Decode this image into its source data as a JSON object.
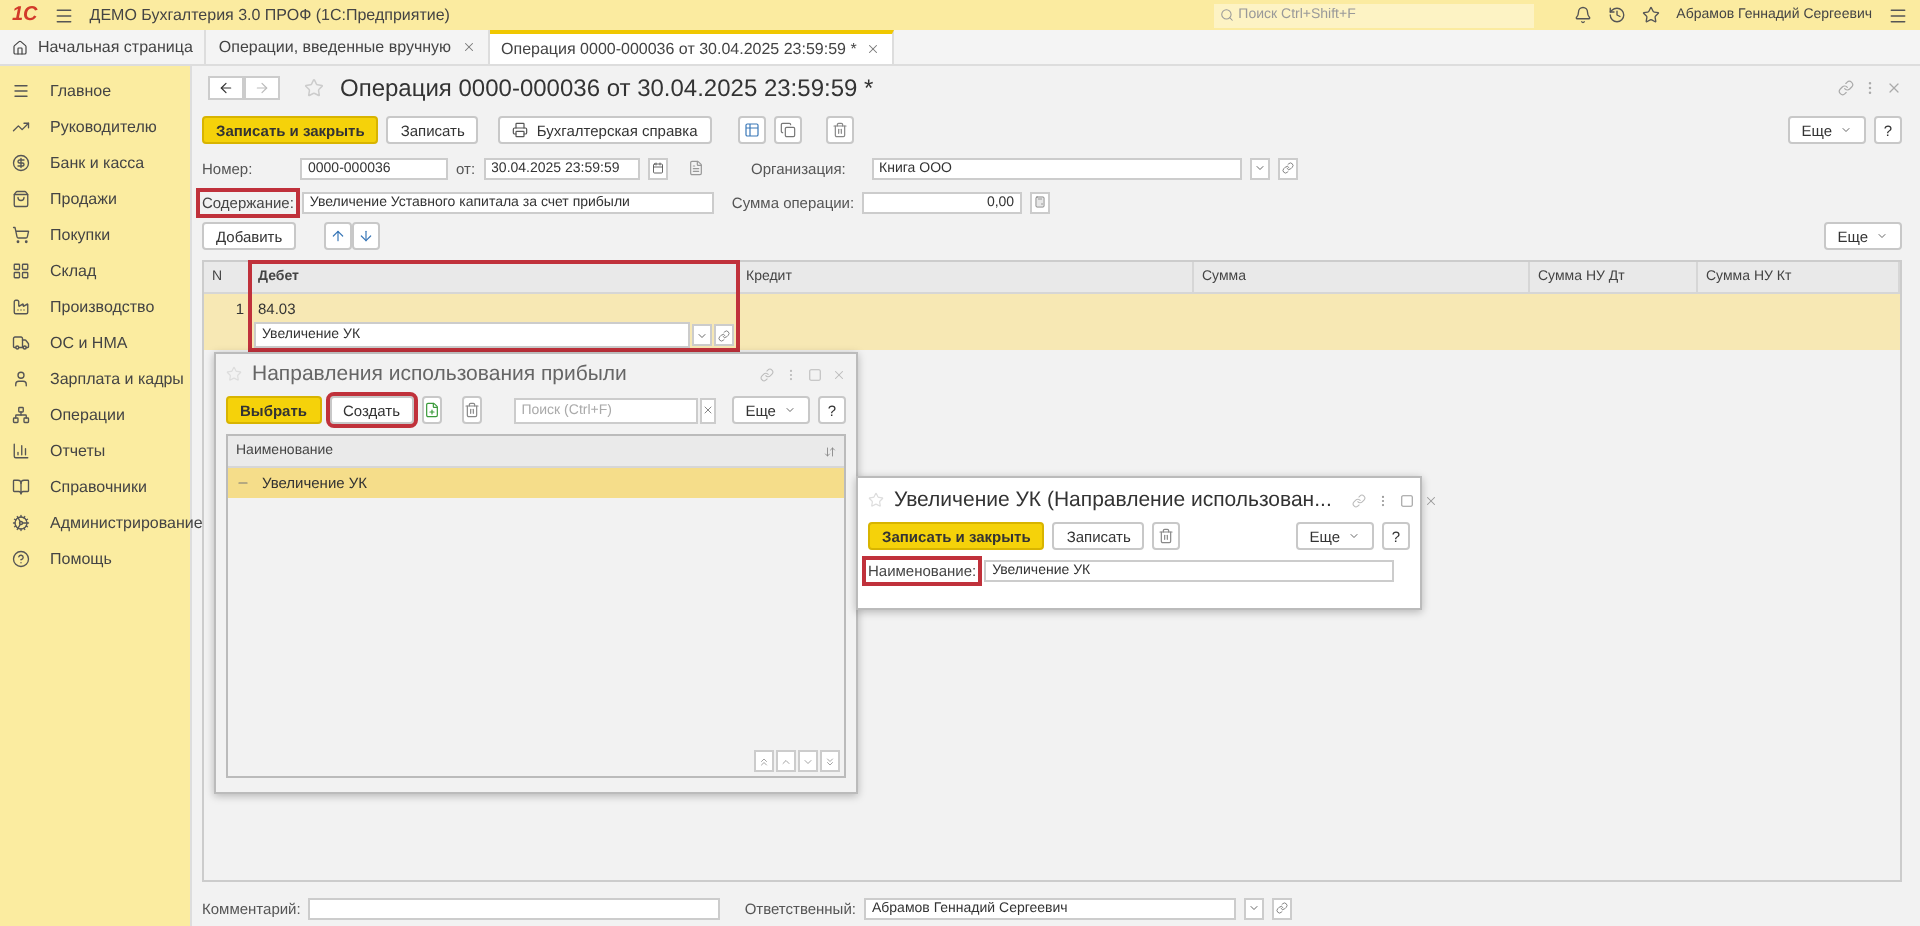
{
  "app": {
    "logo": "1С",
    "title": "ДЕМО Бухгалтерия 3.0 ПРОФ  (1С:Предприятие)",
    "search_placeholder": "Поиск Ctrl+Shift+F",
    "user": "Абрамов Геннадий Сергеевич"
  },
  "tabs": [
    {
      "label": "Начальная страница",
      "kind": "home",
      "selected": false
    },
    {
      "label": "Операции, введенные вручную",
      "kind": "page",
      "selected": false
    },
    {
      "label": "Операция 0000-000036 от 30.04.2025 23:59:59 *",
      "kind": "page",
      "selected": true
    }
  ],
  "sidebar": {
    "items": [
      {
        "label": "Главное"
      },
      {
        "label": "Руководителю"
      },
      {
        "label": "Банк и касса"
      },
      {
        "label": "Продажи"
      },
      {
        "label": "Покупки"
      },
      {
        "label": "Склад"
      },
      {
        "label": "Производство"
      },
      {
        "label": "ОС и НМА"
      },
      {
        "label": "Зарплата и кадры"
      },
      {
        "label": "Операции"
      },
      {
        "label": "Отчеты"
      },
      {
        "label": "Справочники"
      },
      {
        "label": "Администрирование"
      },
      {
        "label": "Помощь"
      }
    ]
  },
  "form": {
    "title": "Операция 0000-000036 от 30.04.2025 23:59:59 *",
    "toolbar": [
      {
        "label": "Записать и закрыть",
        "kind": "primary"
      },
      {
        "label": "Записать",
        "kind": "default"
      },
      {
        "label": "Бухгалтерская справка",
        "kind": "print"
      }
    ],
    "more": "Еще",
    "help": "?",
    "number": {
      "label": "Номер:",
      "value": "0000-000036"
    },
    "date": {
      "label": "от:",
      "value": "30.04.2025 23:59:59"
    },
    "organization": {
      "label": "Организация:",
      "value": "Книга ООО"
    },
    "content": {
      "label": "Содержание:",
      "value": "Увеличение Уставного капитала за счет прибыли",
      "highlighted": true
    },
    "amount": {
      "label": "Сумма операции:",
      "value": "0,00"
    },
    "add_button": "Добавить",
    "table_more": "Еще",
    "table": {
      "columns": [
        {
          "title": "N",
          "highlighted": false
        },
        {
          "title": "Дебет",
          "highlighted": true
        },
        {
          "title": "Кредит",
          "highlighted": false
        },
        {
          "title": "Сумма",
          "highlighted": false
        },
        {
          "title": "Сумма НУ Дт",
          "highlighted": false
        },
        {
          "title": "Сумма НУ Кт",
          "highlighted": false
        }
      ],
      "rows": [
        {
          "number": "1",
          "selected": true,
          "debit_account": "84.03",
          "debit_subconto": "Увеличение УК"
        }
      ]
    },
    "comment": {
      "label": "Комментарий:"
    },
    "responsible": {
      "label": "Ответственный:",
      "value": "Абрамов Геннадий Сергеевич"
    }
  },
  "picker": {
    "title": "Направления использования прибыли",
    "buttons": [
      {
        "label": "Выбрать",
        "kind": "primary",
        "highlighted": false
      },
      {
        "label": "Создать",
        "kind": "default",
        "highlighted": true
      }
    ],
    "search_placeholder": "Поиск (Ctrl+F)",
    "more": "Еще",
    "help": "?",
    "column": "Наименование",
    "rows": [
      {
        "label": "Увеличение УК",
        "selected": true
      }
    ]
  },
  "editor": {
    "title": "Увеличение УК (Направление использован...",
    "buttons": [
      {
        "label": "Записать и закрыть",
        "kind": "primary"
      },
      {
        "label": "Записать",
        "kind": "default"
      }
    ],
    "more": "Еще",
    "help": "?",
    "field": {
      "label": "Наименование:",
      "value": "Увеличение УК",
      "highlighted": true
    }
  }
}
